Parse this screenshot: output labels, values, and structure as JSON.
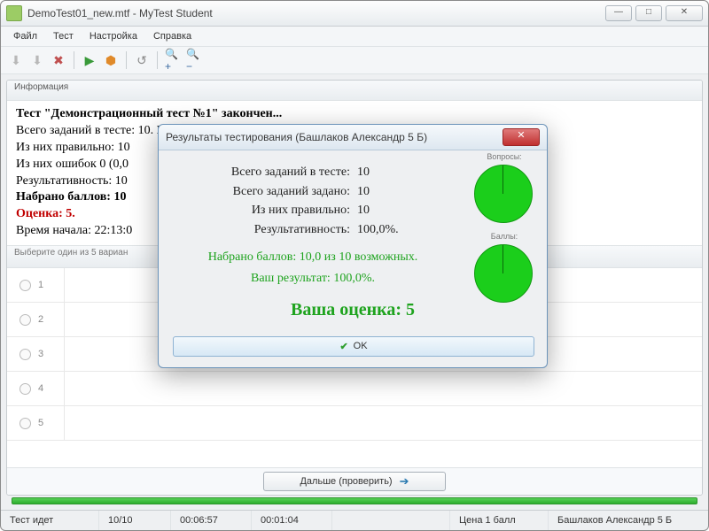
{
  "window": {
    "title": "DemoTest01_new.mtf - MyTest Student",
    "min": "—",
    "max": "□",
    "close": "✕"
  },
  "menu": {
    "items": [
      "Файл",
      "Тест",
      "Настройка",
      "Справка"
    ]
  },
  "toolbar_icons": [
    "⬇",
    "⬇",
    "✖",
    "▶",
    "⬢",
    "↺",
    "🔍+",
    "🔍−"
  ],
  "panel": {
    "header": "Информация"
  },
  "info": {
    "l1a": "Тест \"Демонстрационный тест №1\" закончен...",
    "l2": "Всего заданий в тесте: 10. Вами выполнено заданий: 10.",
    "l3": "Из них правильно: 10",
    "l4": "Из них ошибок 0 (0,0",
    "l5": "Результативность: 10",
    "l6": "Набрано баллов: 10",
    "l7": "Оценка: 5.",
    "l8": "Время начала: 22:13:0"
  },
  "optbar": "Выберите один из 5 вариан",
  "answers": [
    "1",
    "2",
    "3",
    "4",
    "5"
  ],
  "next": {
    "label": "Дальше (проверить)"
  },
  "status": {
    "s1": "Тест идет",
    "s2": "10/10",
    "s3": "00:06:57",
    "s4": "00:01:04",
    "s5": "Цена 1 балл",
    "s6": "Башлаков Александр 5 Б"
  },
  "modal": {
    "title": "Результаты тестирования (Башлаков Александр 5 Б)",
    "rows": [
      {
        "lbl": "Всего заданий в тесте:",
        "val": "10"
      },
      {
        "lbl": "Всего заданий задано:",
        "val": "10"
      },
      {
        "lbl": "Из них правильно:",
        "val": "10"
      },
      {
        "lbl": "Результативность:",
        "val": "100,0%."
      }
    ],
    "line_a": "Набрано баллов: 10,0 из 10 возможных.",
    "line_b": "Ваш результат: 100,0%.",
    "grade": "Ваша оценка: 5",
    "pie1_lbl": "Вопросы:",
    "pie2_lbl": "Баллы:",
    "ok": "OK"
  }
}
